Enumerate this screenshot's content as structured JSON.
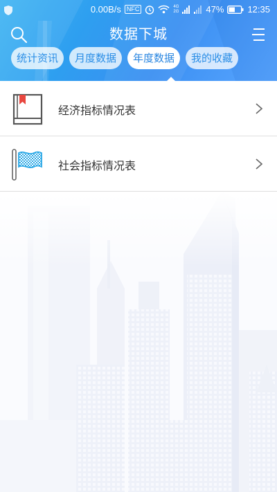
{
  "status_bar": {
    "speed": "0.00B/s",
    "nfc": "NFC",
    "net_small_top": "4G",
    "net_small_bottom": "2G",
    "battery": "47%",
    "time": "12:35"
  },
  "header": {
    "title": "数据下城",
    "tabs": [
      {
        "label": "统计资讯",
        "active": false
      },
      {
        "label": "月度数据",
        "active": false
      },
      {
        "label": "年度数据",
        "active": true
      },
      {
        "label": "我的收藏",
        "active": false
      }
    ]
  },
  "list": {
    "items": [
      {
        "label": "经济指标情况表",
        "icon": "book-icon"
      },
      {
        "label": "社会指标情况表",
        "icon": "flag-icon"
      }
    ]
  },
  "colors": {
    "header_blue": "#2e9ff0",
    "tab_text": "#2b8ee6",
    "book_red": "#e8473f",
    "flag_blue": "#2aa8e6"
  }
}
